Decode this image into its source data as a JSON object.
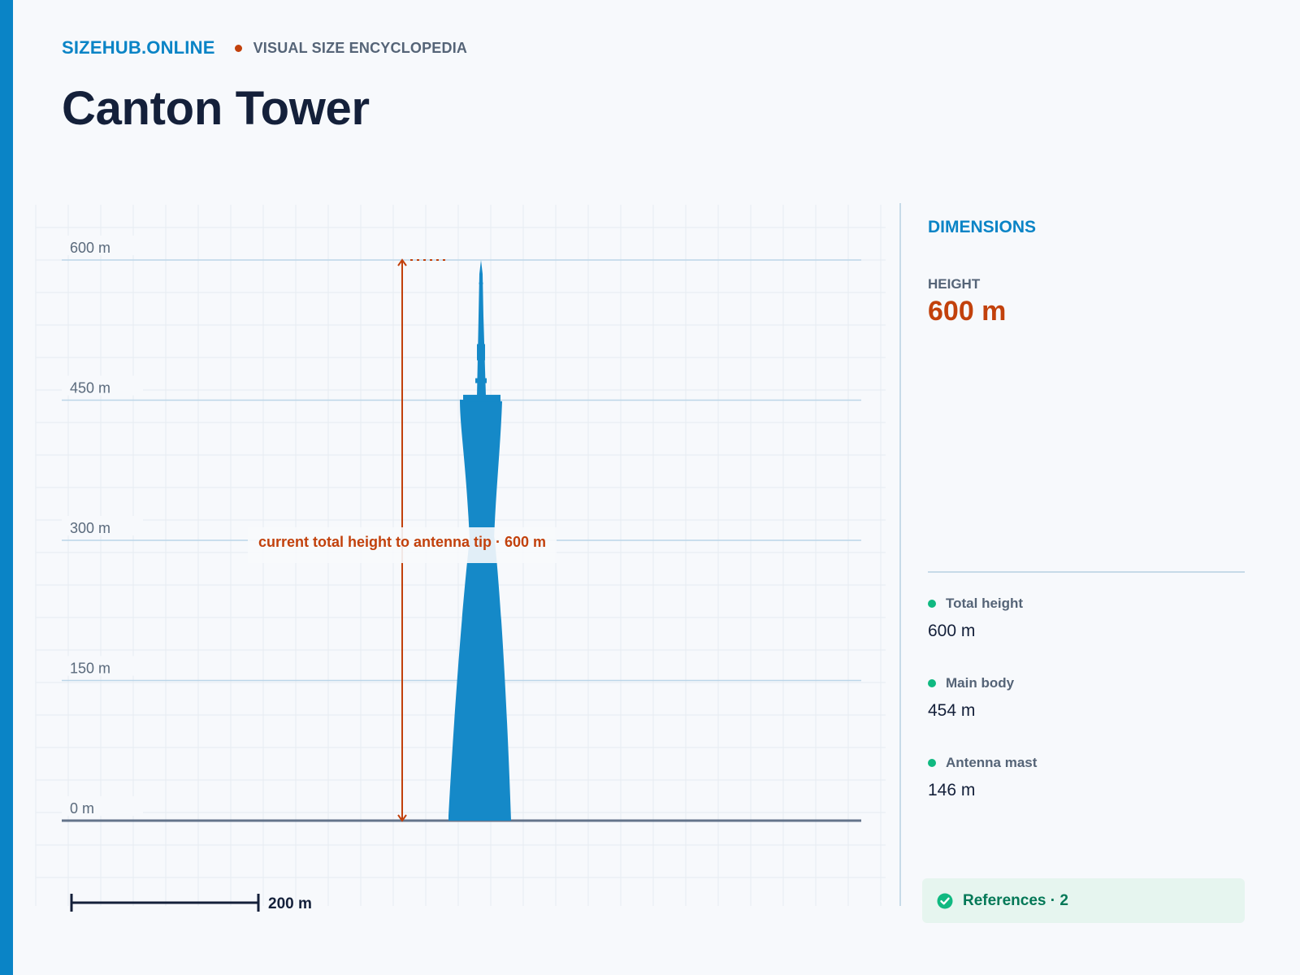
{
  "header": {
    "site_name": "SIZEHUB.ONLINE",
    "tagline": "VISUAL SIZE ENCYCLOPEDIA"
  },
  "page_title": "Canton Tower",
  "diagram": {
    "axis_unit": "m",
    "axis_max": 600,
    "gridlines": [
      {
        "value": 600,
        "label": "600 m"
      },
      {
        "value": 450,
        "label": "450 m"
      },
      {
        "value": 300,
        "label": "300 m"
      },
      {
        "value": 150,
        "label": "150 m"
      },
      {
        "value": 0,
        "label": "0 m"
      }
    ],
    "measure_annotation": "current total height to antenna tip · 600 m",
    "scale_bar_label": "200 m",
    "scale_bar_value": 200,
    "tower_total_height": 600,
    "tower_body_height": 454,
    "tower_color": "#1589c8",
    "annotation_color": "#c2410c"
  },
  "panel": {
    "title": "DIMENSIONS",
    "height_label": "HEIGHT",
    "height_value": "600 m",
    "stats": [
      {
        "label": "Total height",
        "value": "600 m"
      },
      {
        "label": "Main body",
        "value": "454 m"
      },
      {
        "label": "Antenna mast",
        "value": "146 m"
      }
    ],
    "references_label": "References · 2"
  }
}
